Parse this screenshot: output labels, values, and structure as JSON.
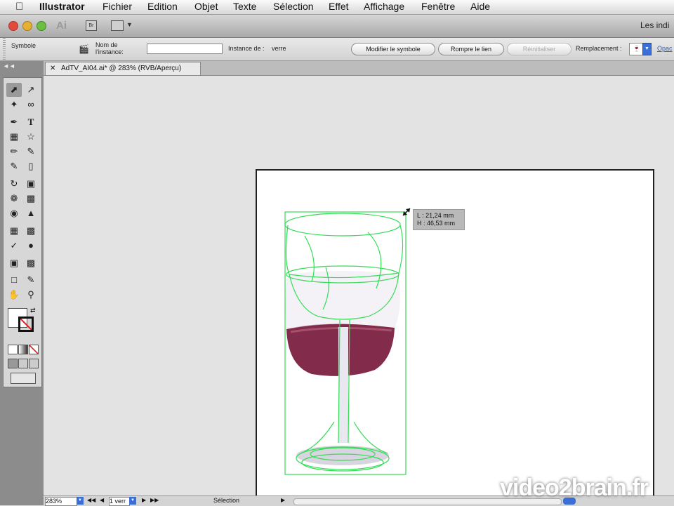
{
  "menubar": {
    "apple": "",
    "app_name": "Illustrator",
    "items": [
      "Fichier",
      "Edition",
      "Objet",
      "Texte",
      "Sélection",
      "Effet",
      "Affichage",
      "Fenêtre",
      "Aide"
    ]
  },
  "apptitle": {
    "ai_logo": "Ai",
    "br_logo": "Br",
    "right_text": "Les indi"
  },
  "controlbar": {
    "object_type": "Symbole",
    "instance_name_label_1": "Nom de",
    "instance_name_label_2": "l'instance:",
    "instance_name_value": "",
    "instance_of_label": "Instance de :",
    "instance_of_value": "verre",
    "modify_symbol": "Modifier le symbole",
    "break_link": "Rompre le lien",
    "reinitialise": "Réinitialiser",
    "replace_label": "Remplacement :",
    "opacity_link": "Opac"
  },
  "document": {
    "tab_title": "AdTV_AI04.ai* @ 283% (RVB/Aperçu)"
  },
  "tooltip": {
    "width": "L : 21,24 mm",
    "height": "H : 46,53 mm"
  },
  "statusbar": {
    "zoom": "283%",
    "artboard": "1 verr",
    "mode": "Sélection"
  },
  "watermark": "video2brain.fr",
  "colors": {
    "selection_green": "#33dd55",
    "wine": "#7c2040",
    "menubar": "#e6e6e6",
    "canvas": "#e3e3e3"
  }
}
